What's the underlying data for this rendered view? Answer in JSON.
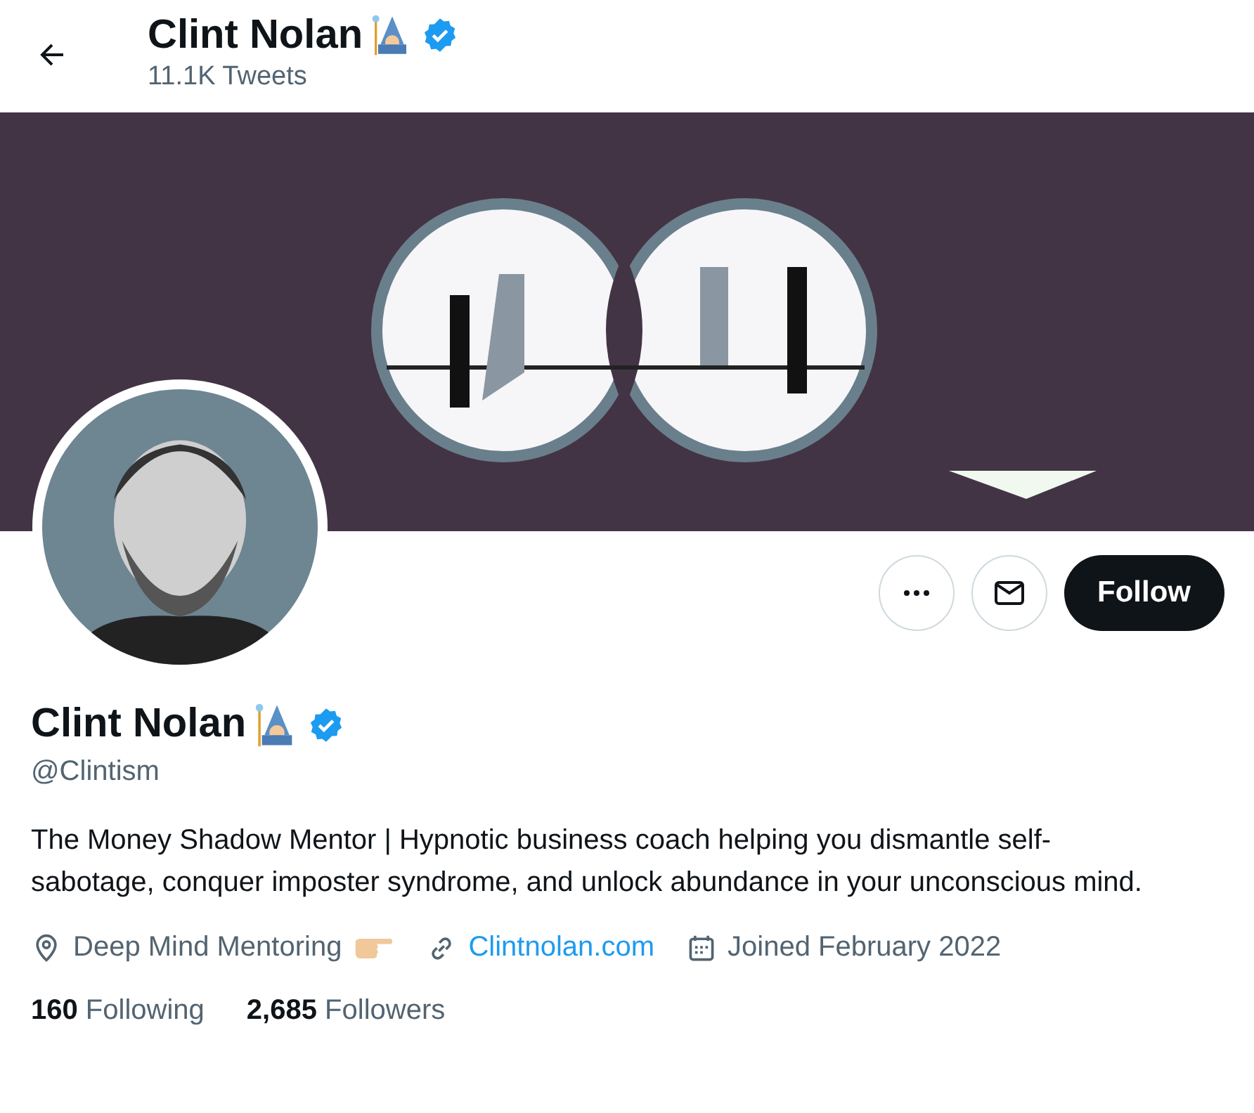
{
  "header": {
    "name": "Clint Nolan",
    "verified": true,
    "tweet_count": "11.1K Tweets"
  },
  "actions": {
    "follow_label": "Follow",
    "following": false
  },
  "profile": {
    "name": "Clint Nolan",
    "verified": true,
    "handle": "@Clintism",
    "bio": "The Money Shadow Mentor | Hypnotic business coach helping you dismantle self-sabotage, conquer imposter syndrome, and unlock abundance in your unconscious mind.",
    "meta": [
      {
        "kind": "location",
        "text": "Deep Mind Mentoring"
      },
      {
        "kind": "link",
        "text": "Clintnolan.com"
      },
      {
        "kind": "joined",
        "text": "Joined February 2022"
      }
    ]
  },
  "stats": [
    {
      "count": "160",
      "label": "Following"
    },
    {
      "count": "2,685",
      "label": "Followers"
    }
  ]
}
